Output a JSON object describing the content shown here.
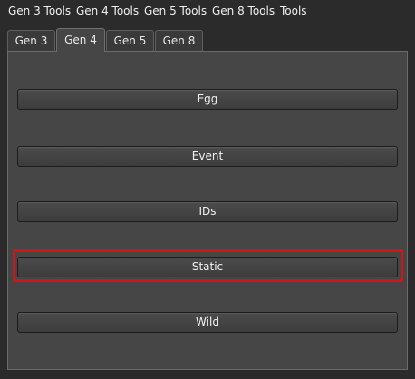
{
  "menubar": {
    "items": [
      {
        "label": "Gen 3 Tools"
      },
      {
        "label": "Gen 4 Tools"
      },
      {
        "label": "Gen 5 Tools"
      },
      {
        "label": "Gen 8 Tools"
      },
      {
        "label": "Tools"
      }
    ]
  },
  "tabs": {
    "items": [
      {
        "label": "Gen 3"
      },
      {
        "label": "Gen 4"
      },
      {
        "label": "Gen 5"
      },
      {
        "label": "Gen 8"
      }
    ],
    "active": "Gen 4"
  },
  "panel": {
    "buttons": [
      {
        "label": "Egg"
      },
      {
        "label": "Event"
      },
      {
        "label": "IDs"
      },
      {
        "label": "Static"
      },
      {
        "label": "Wild"
      }
    ],
    "highlighted": "Static",
    "highlight_color": "#d0151a"
  },
  "colors": {
    "background": "#2b2b2b",
    "panel": "#464646",
    "button": "#3d3d3d",
    "text": "#ffffff"
  }
}
